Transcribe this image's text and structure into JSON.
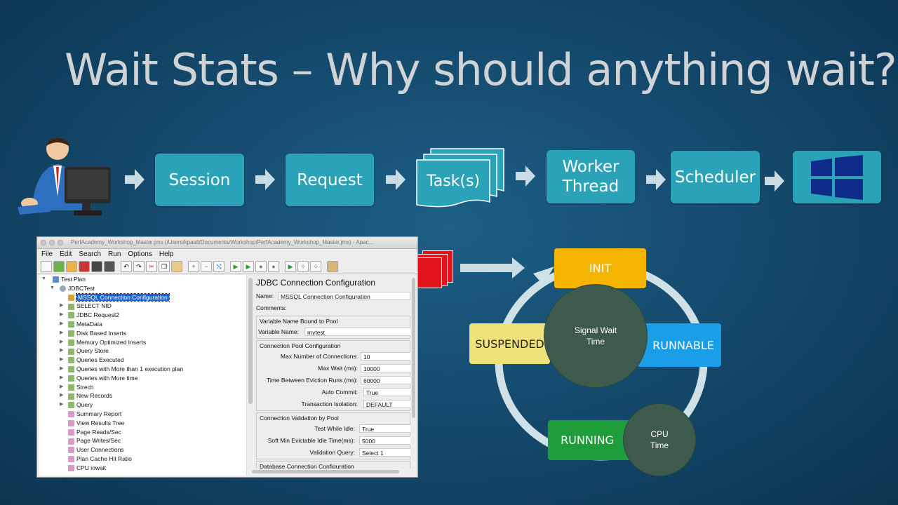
{
  "slide": {
    "title": "Wait Stats – Why should anything wait?"
  },
  "flow": {
    "session": "Session",
    "request": "Request",
    "tasks": "Task(s)",
    "worker_thread_line1": "Worker",
    "worker_thread_line2": "Thread",
    "scheduler": "Scheduler",
    "windows_logo": "windows-logo-icon"
  },
  "jmeter": {
    "title": "PerfAcademy_Workshop_Master.jmx (/Users/kpaidi/Documents/Workshop/PerfAcademy_Workshop_Master.jmx) - Apac...",
    "menu": [
      "File",
      "Edit",
      "Search",
      "Run",
      "Options",
      "Help"
    ],
    "tree": [
      {
        "label": "Test Plan"
      },
      {
        "label": "JDBCTest"
      },
      {
        "label": "MSSQL Connection Configuration"
      },
      {
        "label": "SELECT NID"
      },
      {
        "label": "JDBC Request2"
      },
      {
        "label": "MetaData"
      },
      {
        "label": "Disk Based Inserts"
      },
      {
        "label": "Memory Optimized Inserts"
      },
      {
        "label": "Query Store"
      },
      {
        "label": "Queries Executed"
      },
      {
        "label": "Queries with More than 1 execution plan"
      },
      {
        "label": "Queries with More time"
      },
      {
        "label": "Strech"
      },
      {
        "label": "New Records"
      },
      {
        "label": "Query"
      },
      {
        "label": "Summary Report"
      },
      {
        "label": "View Results Tree"
      },
      {
        "label": "Page Reads/Sec"
      },
      {
        "label": "Page Writes/Sec"
      },
      {
        "label": "User Connections"
      },
      {
        "label": "Plan Cache Hit Ratio"
      },
      {
        "label": "CPU iowait"
      }
    ],
    "panel": {
      "heading": "JDBC Connection Configuration",
      "name_label": "Name:",
      "name_value": "MSSQL Connection Configuration",
      "comments_label": "Comments:",
      "group_var": "Variable Name Bound to Pool",
      "var_label": "Variable Name:",
      "var_value": "mytest",
      "group_pool": "Connection Pool Configuration",
      "max_conn_label": "Max Number of Connections:",
      "max_conn_value": "10",
      "max_wait_label": "Max Wait (ms):",
      "max_wait_value": "10000",
      "evict_label": "Time Between Eviction Runs (ms):",
      "evict_value": "60000",
      "autocommit_label": "Auto Commit:",
      "autocommit_value": "True",
      "isolation_label": "Transaction Isolation:",
      "isolation_value": "DEFAULT",
      "group_valid": "Connection Validation by Pool",
      "idle_label": "Test While Idle:",
      "idle_value": "True",
      "softmin_label": "Soft Min Evictable Idle Time(ms):",
      "softmin_value": "5000",
      "vquery_label": "Validation Query:",
      "vquery_value": "Select 1",
      "group_db": "Database Connection Configuration"
    }
  },
  "cycle": {
    "init": "INIT",
    "runnable": "RUNNABLE",
    "running": "RUNNING",
    "suspended": "SUSPENDED",
    "signal_wait_line1": "Signal Wait",
    "signal_wait_line2": "Time",
    "cpu_line1": "CPU",
    "cpu_line2": "Time"
  },
  "colors": {
    "flow_box": "#2aa3b8",
    "init": "#f5b400",
    "runnable": "#1a9ee8",
    "running": "#1e9e3a",
    "suspended": "#f0e27a",
    "circle": "#3d5a4d",
    "ring": "#cfe0e6"
  }
}
